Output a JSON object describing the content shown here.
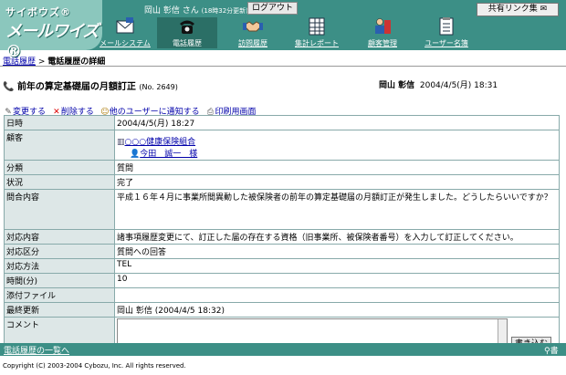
{
  "header": {
    "logo_small": "サイボウズ®",
    "logo_big": "メールワイズ®",
    "user_name": "岡山 彰信",
    "user_suffix": "さん",
    "user_note": "(18時32分更新)",
    "logout": "ログアウト",
    "shared_link": "共有リンク集"
  },
  "nav": [
    {
      "label": "メールシステム",
      "icon": "mail-icon"
    },
    {
      "label": "電話履歴",
      "icon": "phone-icon"
    },
    {
      "label": "訪問履歴",
      "icon": "handshake-icon"
    },
    {
      "label": "集計レポート",
      "icon": "report-icon"
    },
    {
      "label": "顧客管理",
      "icon": "customer-icon"
    },
    {
      "label": "ユーザー名簿",
      "icon": "user-list-icon"
    }
  ],
  "breadcrumb": {
    "parent": "電話履歴",
    "separator": " > ",
    "current": "電話履歴の詳細"
  },
  "record": {
    "title": "前年の算定基礎届の月額訂正",
    "number": "(No. 2649)",
    "author": "岡山 彰信",
    "date": "2004/4/5(月) 18:31"
  },
  "actions": {
    "edit": "変更する",
    "delete": "削除する",
    "notify": "他のユーザーに通知する",
    "print": "印刷用画面"
  },
  "fields": {
    "datetime_label": "日時",
    "datetime_value": "2004/4/5(月) 18:27",
    "customer_label": "顧客",
    "customer_org": "○○○健康保険組合",
    "customer_person": "今田　誠一　様",
    "category_label": "分類",
    "category_value": "質問",
    "status_label": "状況",
    "status_value": "完了",
    "inquiry_label": "問合内容",
    "inquiry_value": "平成１６年４月に事業所間異動した被保険者の前年の算定基礎届の月額訂正が発生しました。どうしたらいいですか？",
    "response_label": "対応内容",
    "response_value": "諸事項履歴変更にて、訂正した届の存在する資格（旧事業所、被保険者番号）を入力して訂正してください。",
    "response_type_label": "対応区分",
    "response_type_value": "質問への回答",
    "method_label": "対応方法",
    "method_value": "TEL",
    "time_label": "時間(分)",
    "time_value": "10",
    "attach_label": "添付ファイル",
    "attach_value": "",
    "updated_label": "最終更新",
    "updated_value": "岡山 彰信 (2004/4/5 18:32)",
    "comment_label": "コメント",
    "write_button": "書き込む"
  },
  "footer": {
    "back_link": "電話履歴の一覧へ",
    "right_text": "書",
    "copyright": "Copyright (C) 2003-2004 Cybozu, Inc. All rights reserved."
  }
}
